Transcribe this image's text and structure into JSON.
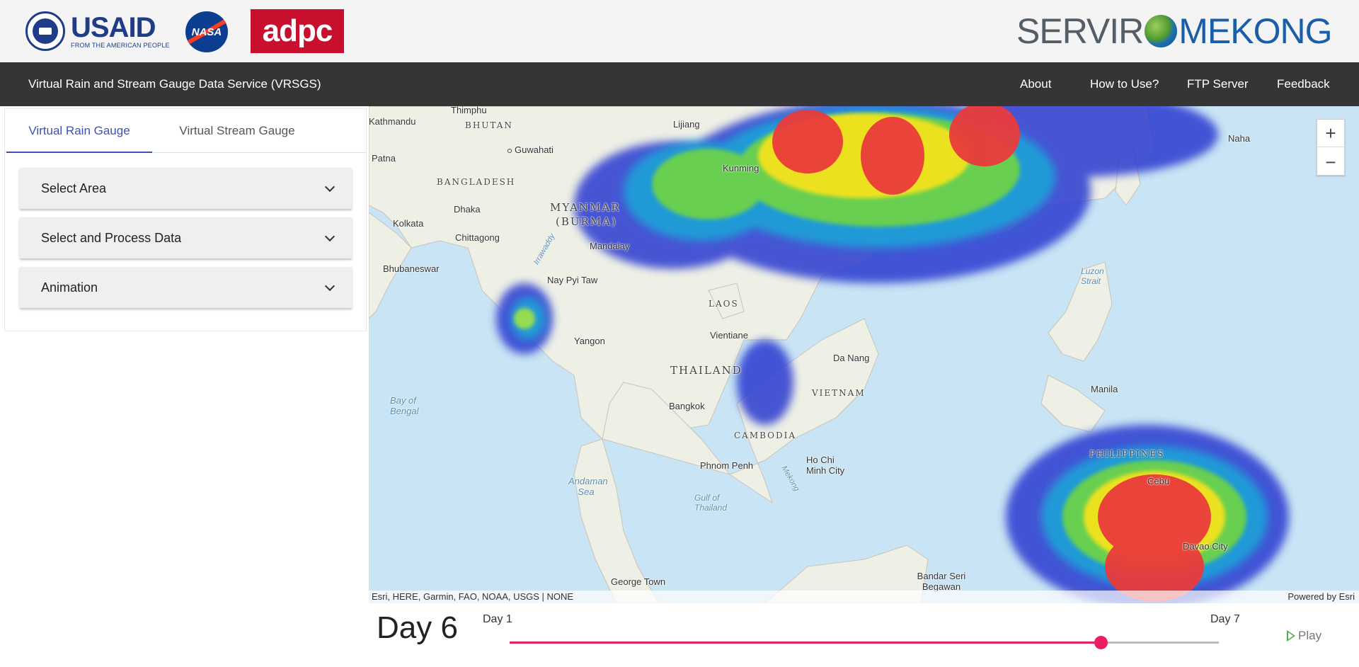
{
  "header": {
    "usaid": {
      "main": "USAID",
      "tagline": "FROM THE AMERICAN PEOPLE"
    },
    "nasa": "NASA",
    "adpc": "adpc",
    "servir": {
      "left": "SERVIR",
      "right": "MEKONG"
    }
  },
  "nav": {
    "title": "Virtual Rain and Stream Gauge Data Service (VRSGS)",
    "links": [
      "About",
      "How to Use?",
      "FTP Server",
      "Feedback"
    ]
  },
  "sidebar": {
    "tabs": [
      {
        "label": "Virtual Rain Gauge",
        "active": true
      },
      {
        "label": "Virtual Stream Gauge",
        "active": false
      }
    ],
    "panels": [
      "Select Area",
      "Select and Process Data",
      "Animation"
    ]
  },
  "map": {
    "zoom_in": "+",
    "zoom_out": "−",
    "attribution_left": "Esri, HERE, Garmin, FAO, NOAA, USGS | NONE",
    "attribution_right": "Powered by Esri",
    "places": {
      "thimphu": "Thimphu",
      "bhutan": "BHUTAN",
      "kathmandu": "Kathmandu",
      "guwahati": "Guwahati",
      "patna": "Patna",
      "bangladesh": "BANGLADESH",
      "dhaka": "Dhaka",
      "kolkata": "Kolkata",
      "chittagong": "Chittagong",
      "myanmar": "MYANMAR",
      "burma": "(BURMA)",
      "mandalay": "Mandalay",
      "bhubaneswar": "Bhubaneswar",
      "naypyitaw": "Nay Pyi Taw",
      "yangon": "Yangon",
      "laos": "LAOS",
      "vientiane": "Vientiane",
      "thailand": "THAILAND",
      "bangkok": "Bangkok",
      "vietnam": "VIETNAM",
      "danang": "Da Nang",
      "cambodia": "CAMBODIA",
      "phnompenh": "Phnom Penh",
      "hochiminh": "Ho Chi Minh City",
      "bayofbengal": "Bay of Bengal",
      "andaman": "Andaman Sea",
      "gulf": "Gulf of Thailand",
      "georgetown": "George Town",
      "bandarseri": "Bandar Seri Begawan",
      "manila": "Manila",
      "philippines": "PHILIPPINES",
      "cebu": "Cebu",
      "davao": "Davao City",
      "kunming": "Kunming",
      "lijiang": "Lijiang",
      "naha": "Naha",
      "luzon": "Luzon Strait",
      "mekong": "Mekong",
      "irrawaddy": "Irrawaddy"
    }
  },
  "animation": {
    "current_day_label": "Day 6",
    "start_label": "Day 1",
    "end_label": "Day 7",
    "current_day": 6,
    "min_day": 1,
    "max_day": 7,
    "play_label": "Play",
    "accent_color": "#e91e63"
  }
}
